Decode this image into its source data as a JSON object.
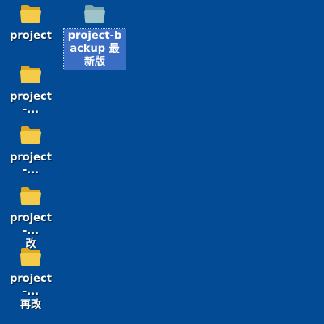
{
  "desktop": {
    "background_color": "#034b94",
    "icons": [
      {
        "label": "project",
        "icon": "folder-icon",
        "selected": false
      },
      {
        "label": "project-backup 最新版",
        "icon": "folder-icon",
        "selected": true
      },
      {
        "label": "project-...",
        "icon": "folder-icon",
        "selected": false
      },
      {
        "label": "project-...",
        "icon": "folder-icon",
        "selected": false
      },
      {
        "label": "project-...\n改",
        "icon": "folder-icon",
        "selected": false
      },
      {
        "label": "project-...\n再改",
        "icon": "folder-icon",
        "selected": false
      }
    ]
  },
  "colors": {
    "folder_front": "#f5cc4a",
    "folder_back": "#e0a81e",
    "selection_bg": "#3a6ec4"
  }
}
